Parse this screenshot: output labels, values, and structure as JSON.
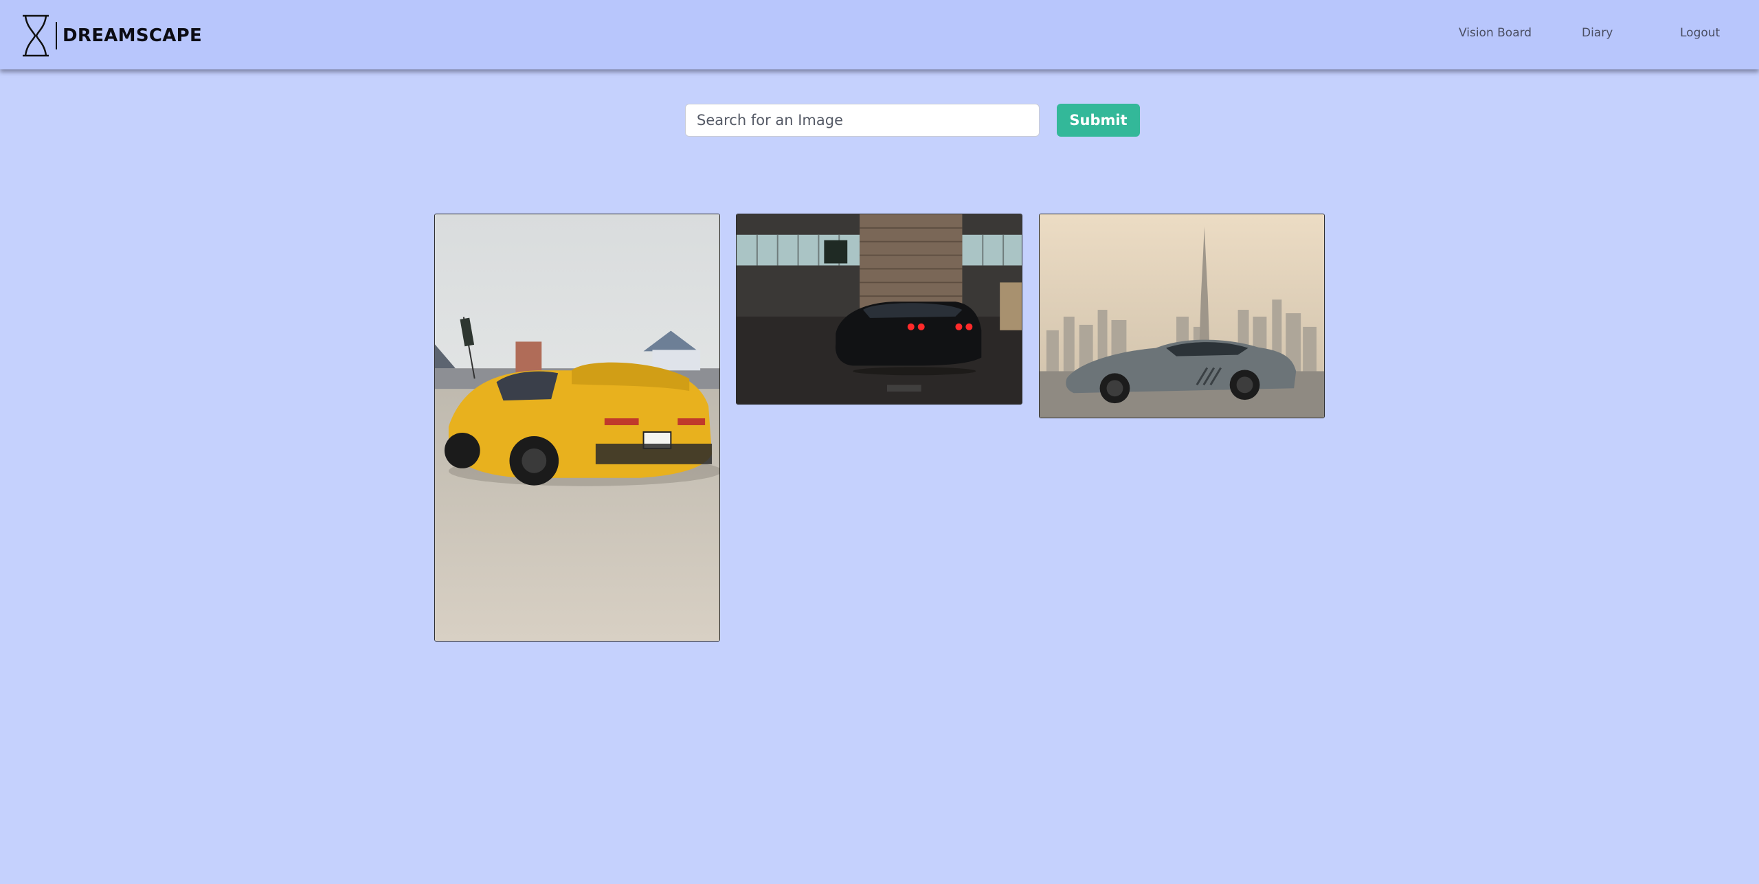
{
  "brand": {
    "name": "DREAMSCAPE",
    "logo_icon": "hourglass-icon"
  },
  "nav": {
    "vision_board": "Vision Board",
    "diary": "Diary",
    "logout": "Logout"
  },
  "search": {
    "placeholder": "Search for an Image",
    "value": "",
    "submit_label": "Submit"
  },
  "results": [
    {
      "subject": "yellow sports car at event"
    },
    {
      "subject": "black sports car in garage"
    },
    {
      "subject": "grey sports car with city skyline"
    }
  ],
  "colors": {
    "background": "#c5d1fd",
    "navbar": "#b8c6fc",
    "submit": "#33b899"
  }
}
